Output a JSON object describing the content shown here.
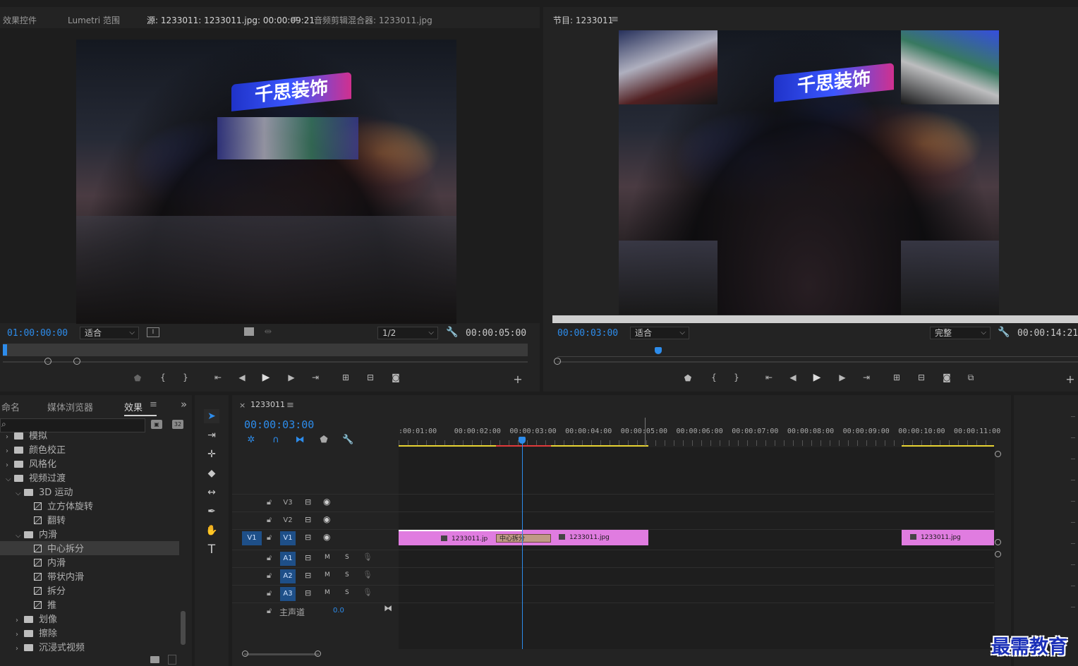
{
  "source_panel": {
    "tabs": [
      "效果控件",
      "Lumetri 范围",
      "源: 1233011: 1233011.jpg: 00:00:09:21",
      "音频剪辑混合器: 1233011.jpg"
    ],
    "menu_glyph": "≡",
    "timecode_current": "01:00:00:00",
    "fit": "适合",
    "resolution": "1/2",
    "duration": "00:00:05:00"
  },
  "program_panel": {
    "title": "节目: 1233011",
    "menu_glyph": "≡",
    "timecode_current": "00:00:03:00",
    "fit": "适合",
    "quality": "完整",
    "duration": "00:00:14:21"
  },
  "video_sign_text": "千思装饰",
  "project_panel": {
    "tabs": [
      "命名",
      "媒体浏览器",
      "效果"
    ],
    "menu_glyph": "≡",
    "expand_glyph": "»",
    "search_placeholder": "",
    "tree": [
      {
        "label": "模拟",
        "indent": 0,
        "type": "folder",
        "expanded": false
      },
      {
        "label": "颜色校正",
        "indent": 0,
        "type": "folder",
        "expanded": false
      },
      {
        "label": "风格化",
        "indent": 0,
        "type": "folder",
        "expanded": false
      },
      {
        "label": "视频过渡",
        "indent": 0,
        "type": "folder",
        "expanded": true
      },
      {
        "label": "3D 运动",
        "indent": 1,
        "type": "folder",
        "expanded": true
      },
      {
        "label": "立方体旋转",
        "indent": 2,
        "type": "effect"
      },
      {
        "label": "翻转",
        "indent": 2,
        "type": "effect"
      },
      {
        "label": "内滑",
        "indent": 1,
        "type": "folder",
        "expanded": true
      },
      {
        "label": "中心拆分",
        "indent": 2,
        "type": "effect",
        "selected": true
      },
      {
        "label": "内滑",
        "indent": 2,
        "type": "effect"
      },
      {
        "label": "带状内滑",
        "indent": 2,
        "type": "effect"
      },
      {
        "label": "拆分",
        "indent": 2,
        "type": "effect"
      },
      {
        "label": "推",
        "indent": 2,
        "type": "effect"
      },
      {
        "label": "划像",
        "indent": 1,
        "type": "folder",
        "expanded": false
      },
      {
        "label": "擦除",
        "indent": 1,
        "type": "folder",
        "expanded": false
      },
      {
        "label": "沉浸式视频",
        "indent": 1,
        "type": "folder",
        "expanded": false
      }
    ]
  },
  "timeline": {
    "sequence_tab": "1233011",
    "close_glyph": "×",
    "menu_glyph": "≡",
    "timecode": "00:00:03:00",
    "ruler_labels": [
      ":00:01:00",
      "00:00:02:00",
      "00:00:03:00",
      "00:00:04:00",
      "00:00:05:00",
      "00:00:06:00",
      "00:00:07:00",
      "00:00:08:00",
      "00:00:09:00",
      "00:00:10:00",
      "00:00:11:00"
    ],
    "video_tracks": [
      "V3",
      "V2",
      "V1"
    ],
    "source_patch": "V1",
    "audio_tracks": [
      "A1",
      "A2",
      "A3"
    ],
    "mute": "M",
    "solo": "S",
    "master_label": "主声道",
    "master_value": "0.0",
    "clips": [
      {
        "name": "1233011.jp"
      },
      {
        "name": "1233011.jpg"
      },
      {
        "name": "1233011.jpg"
      }
    ],
    "transition": "中心拆分"
  },
  "watermark": "最需教育"
}
